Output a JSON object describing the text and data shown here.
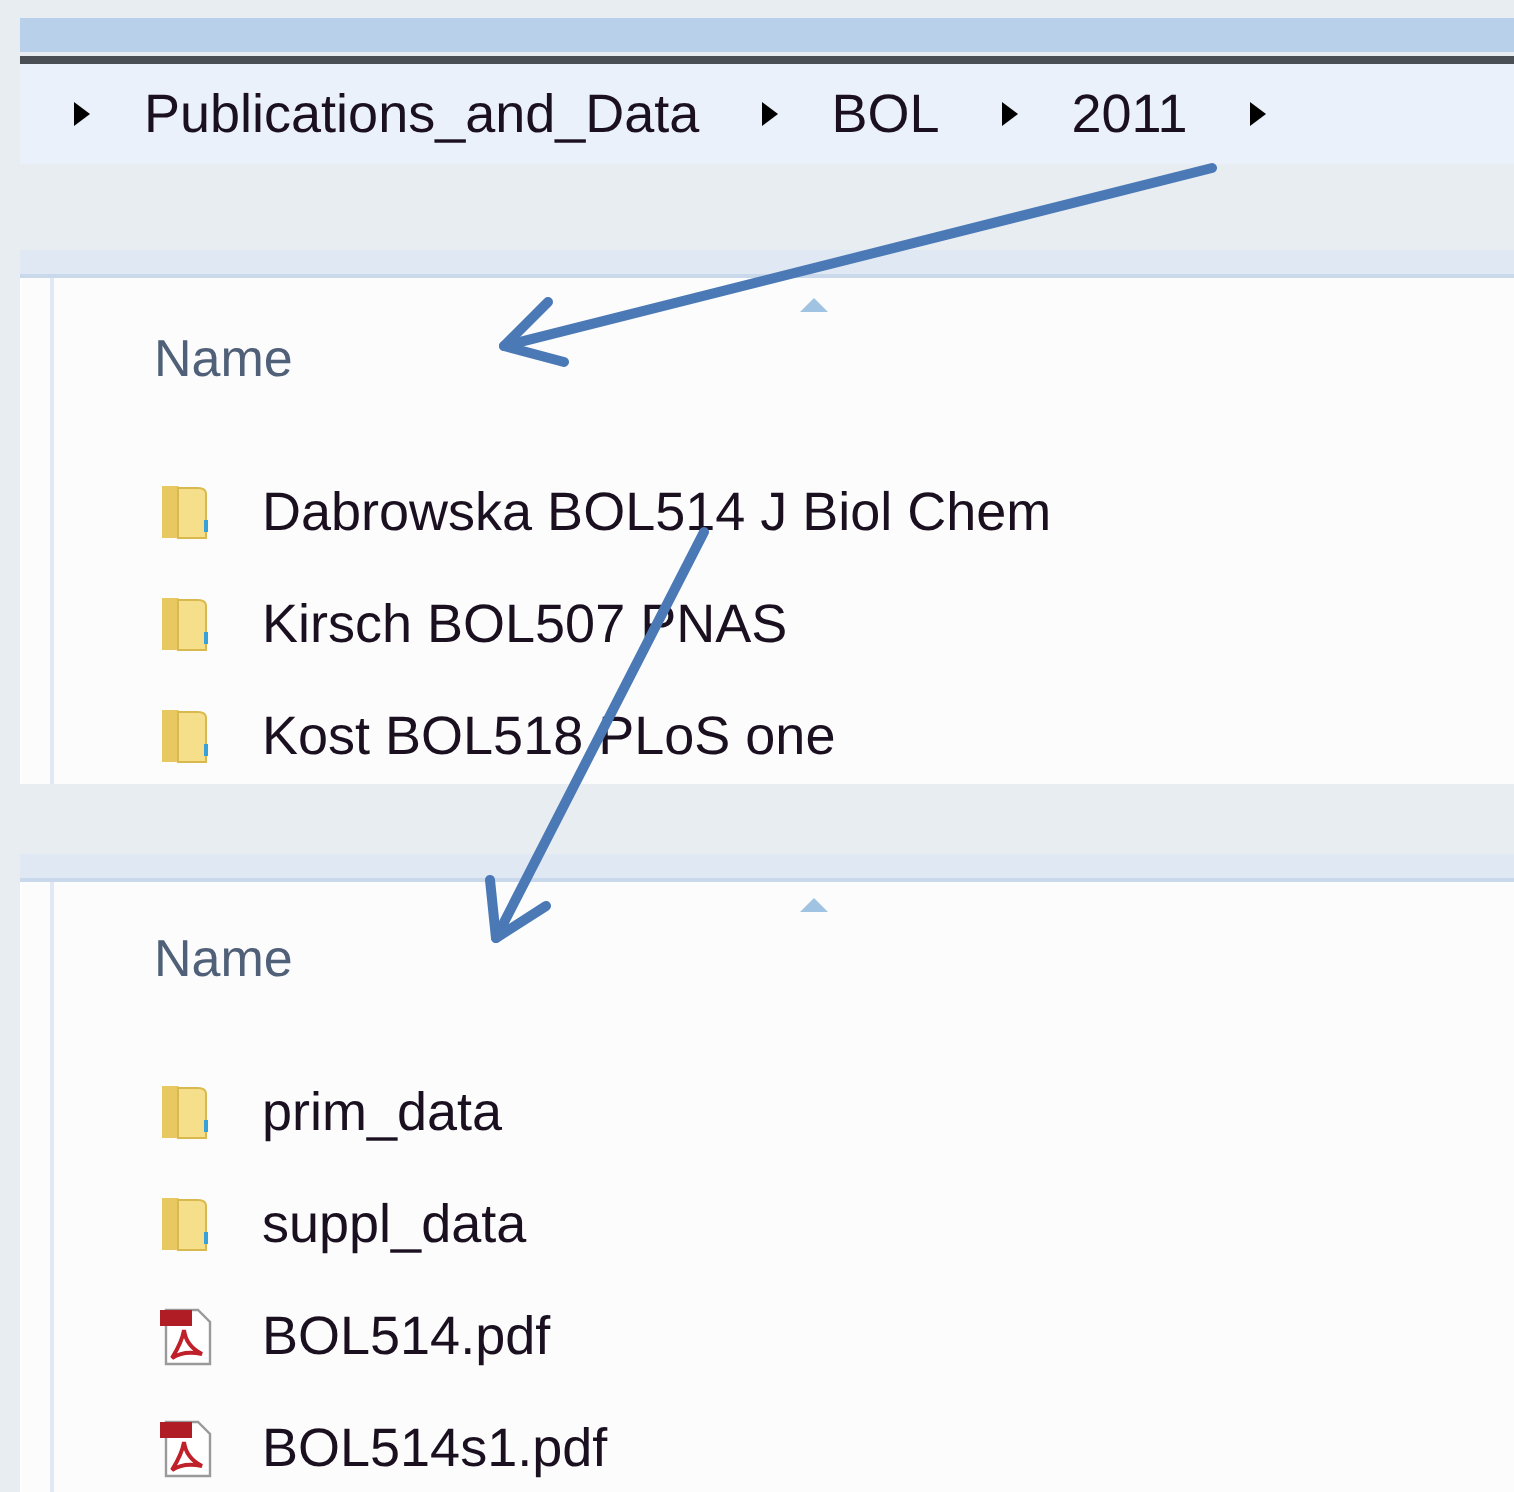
{
  "breadcrumb": [
    "Publications_and_Data",
    "BOL",
    "2011"
  ],
  "panes": [
    {
      "column": "Name",
      "items": [
        {
          "name": "Dabrowska BOL514 J Biol Chem",
          "kind": "folder"
        },
        {
          "name": "Kirsch BOL507 PNAS",
          "kind": "folder"
        },
        {
          "name": "Kost BOL518 PLoS one",
          "kind": "folder"
        }
      ]
    },
    {
      "column": "Name",
      "items": [
        {
          "name": "prim_data",
          "kind": "folder"
        },
        {
          "name": "suppl_data",
          "kind": "folder"
        },
        {
          "name": "BOL514.pdf",
          "kind": "pdf"
        },
        {
          "name": "BOL514s1.pdf",
          "kind": "pdf"
        }
      ]
    }
  ]
}
